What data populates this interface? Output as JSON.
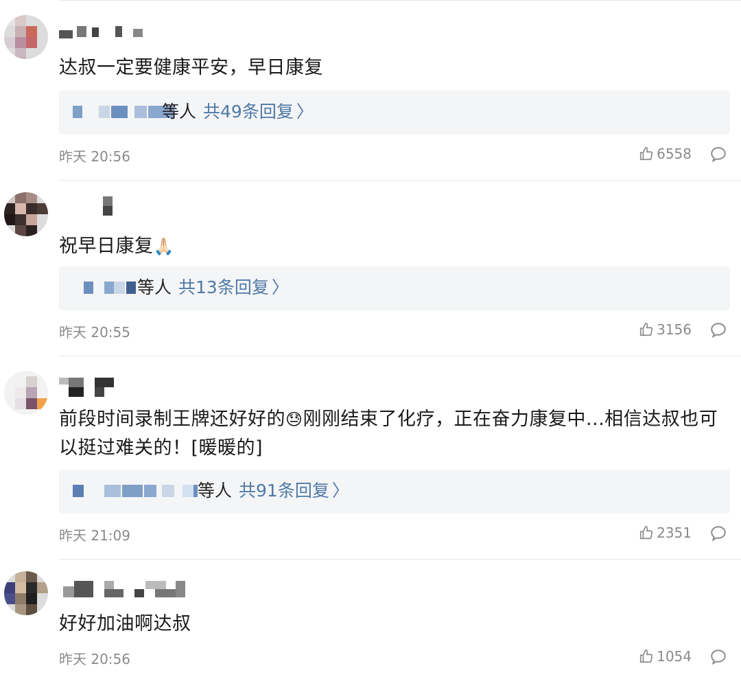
{
  "comments": [
    {
      "text": "达叔一定要健康平安，早日康复",
      "reply_others": "等人",
      "reply_count": "共49条回复",
      "time": "昨天 20:56",
      "likes": "6558"
    },
    {
      "text": "祝早日康复",
      "emoji": "🙏🏻",
      "reply_others": "等人",
      "reply_count": "共13条回复",
      "time": "昨天 20:55",
      "likes": "3156"
    },
    {
      "text_before": "前段时间录制王牌还好好的",
      "emoji": "😓",
      "text_after": "刚刚结束了化疗，正在奋力康复中...相信达叔也可以挺过难关的！[暖暖的]",
      "reply_others": "等人",
      "reply_count": "共91条回复",
      "time": "昨天 21:09",
      "likes": "2351"
    },
    {
      "text": "好好加油啊达叔",
      "time": "昨天 20:56",
      "likes": "1054"
    }
  ],
  "icons": {
    "like": "thumbs-up-icon",
    "reply": "comment-bubble-icon",
    "chevron": "chevron-right-icon"
  },
  "colors": {
    "link": "#4e79a7",
    "meta": "#8a8a8a",
    "reply_bg": "#f4f5f7"
  }
}
